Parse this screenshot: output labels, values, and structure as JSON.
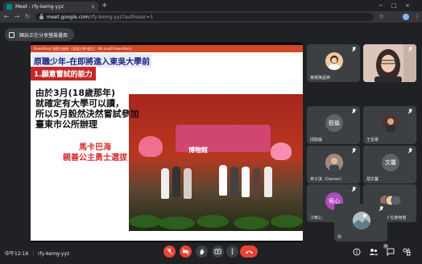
{
  "browser": {
    "tab_title": "Meet - rfy-kemg-yyz",
    "tab_close": "×",
    "new_tab": "+",
    "url_host": "meet.google.com",
    "url_path": "/rfy-kemg-yyz?authuser=1",
    "nav_back": "←",
    "nav_forward": "→",
    "nav_reload": "↻",
    "win_min": "−",
    "win_max": "□",
    "win_close": "×",
    "star": "☆",
    "menu": "⋮"
  },
  "meet": {
    "share_banner": "歸詠正在分享螢幕畫面",
    "powerpoint_bar": "PowerPoint 投影片放映 - [東吳大學-報告] - Microsoft PowerPoint",
    "slide": {
      "title": "原職少年-在即將進入東吳大學前",
      "subtitle": "1.願意嘗試的能力",
      "lines": [
        "由於3月(18歲那年)",
        "就確定有大學可以讀，",
        "所以5月毅然決然嘗試參加",
        "臺東市公所辦理"
      ],
      "red_lines": [
        "馬卡巴海",
        "親善公主勇士選拔"
      ],
      "photo_banner": "博物館"
    },
    "participants": [
      {
        "name": "東吳陳孟婷",
        "avatar_type": "photo",
        "color": "#f0c9a0"
      },
      {
        "name": "",
        "avatar_type": "video",
        "color": "#e9d3c8"
      },
      {
        "name": "邱鈺倫",
        "avatar_type": "text",
        "initials": "鈺倫",
        "color": "#5f6368"
      },
      {
        "name": "王晉豪",
        "avatar_type": "photo",
        "color": "#6d4c41"
      },
      {
        "name": "林子淇（Darren）",
        "avatar_type": "photo",
        "color": "#8d6e63"
      },
      {
        "name": "胡文馨",
        "avatar_type": "text",
        "initials": "文馨",
        "color": "#5f6368"
      },
      {
        "name": "江宥心",
        "avatar_type": "text",
        "initials": "宥心",
        "color": "#b04dbb"
      },
      {
        "name": "還有另外 22 位使用者",
        "avatar_type": "more",
        "color": "#3c4043"
      },
      {
        "name": "你",
        "avatar_type": "photo",
        "color": "#90a4ae"
      }
    ],
    "bottom": {
      "time": "中午12:16",
      "separator": "|",
      "meeting_code": "rfy-kemg-yyz",
      "people_count": "31"
    },
    "icons": {
      "mic_off": "mic-off-icon",
      "cam_off": "videocam-off-icon",
      "raise_hand": "hand-icon",
      "present": "present-icon",
      "more": "more-vert-icon",
      "hangup": "call-end-icon",
      "info": "info-icon",
      "people": "people-icon",
      "chat": "chat-icon",
      "activities": "shapes-icon"
    },
    "colors": {
      "hangup": "#ea4335",
      "accent": "#8ab4f8",
      "slide_red": "#c62828"
    }
  }
}
